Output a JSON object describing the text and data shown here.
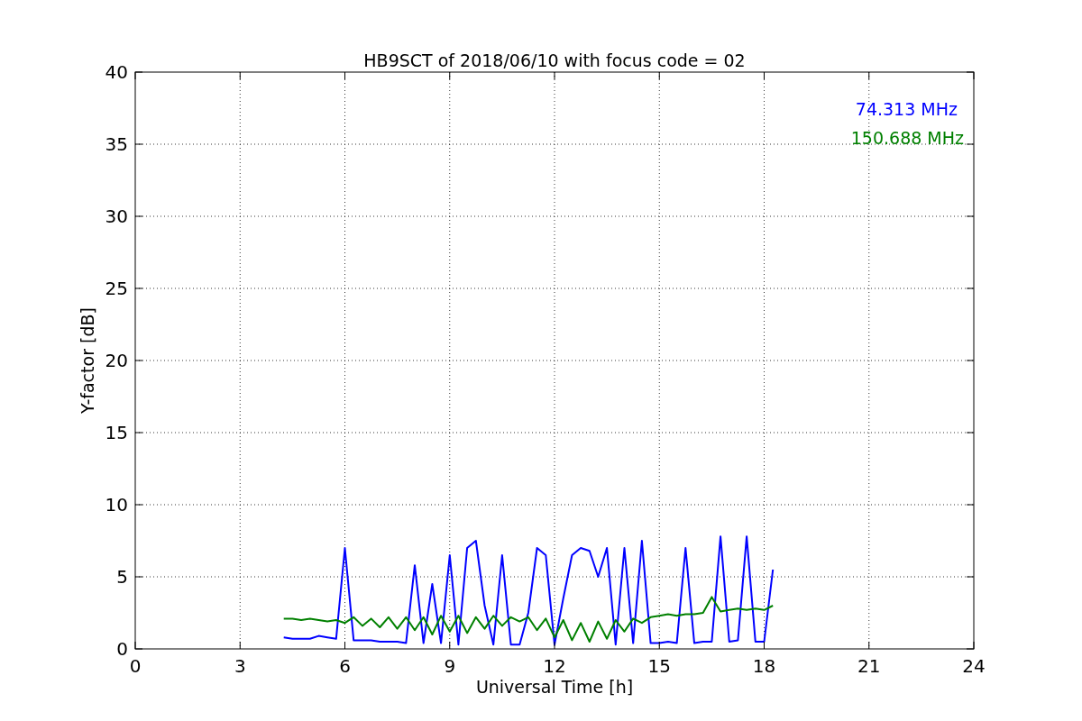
{
  "chart_data": {
    "type": "line",
    "title": "HB9SCT of 2018/06/10 with focus code = 02",
    "xlabel": "Universal Time [h]",
    "ylabel": "Y-factor [dB]",
    "x": [
      4.25,
      4.5,
      4.75,
      5.0,
      5.25,
      5.5,
      5.75,
      6.0,
      6.25,
      6.5,
      6.75,
      7.0,
      7.25,
      7.5,
      7.75,
      8.0,
      8.25,
      8.5,
      8.75,
      9.0,
      9.25,
      9.5,
      9.75,
      10.0,
      10.25,
      10.5,
      10.75,
      11.0,
      11.25,
      11.5,
      11.75,
      12.0,
      12.25,
      12.5,
      12.75,
      13.0,
      13.25,
      13.5,
      13.75,
      14.0,
      14.25,
      14.5,
      14.75,
      15.0,
      15.25,
      15.5,
      15.75,
      16.0,
      16.25,
      16.5,
      16.75,
      17.0,
      17.25,
      17.5,
      17.75,
      18.0,
      18.25
    ],
    "series": [
      {
        "name": "74.313 MHz",
        "color": "#0000ff",
        "values": [
          0.8,
          0.7,
          0.7,
          0.7,
          0.9,
          0.8,
          0.7,
          7.0,
          0.6,
          0.6,
          0.6,
          0.5,
          0.5,
          0.5,
          0.4,
          5.8,
          0.4,
          4.5,
          0.4,
          6.5,
          0.3,
          7.0,
          7.5,
          3.0,
          0.3,
          6.5,
          0.3,
          0.3,
          2.5,
          7.0,
          6.5,
          0.3,
          3.5,
          6.5,
          7.0,
          6.8,
          5.0,
          7.0,
          0.3,
          7.0,
          0.4,
          7.5,
          0.4,
          0.4,
          0.5,
          0.4,
          7.0,
          0.4,
          0.5,
          0.5,
          7.8,
          0.5,
          0.6,
          7.8,
          0.5,
          0.5,
          5.5
        ]
      },
      {
        "name": "150.688 MHz",
        "color": "#008000",
        "values": [
          2.1,
          2.1,
          2.0,
          2.1,
          2.0,
          1.9,
          2.0,
          1.8,
          2.2,
          1.6,
          2.1,
          1.5,
          2.2,
          1.4,
          2.2,
          1.3,
          2.2,
          1.0,
          2.3,
          1.2,
          2.3,
          1.1,
          2.2,
          1.4,
          2.3,
          1.6,
          2.2,
          1.9,
          2.2,
          1.3,
          2.1,
          0.8,
          2.0,
          0.6,
          1.8,
          0.5,
          1.9,
          0.7,
          2.0,
          1.2,
          2.1,
          1.8,
          2.2,
          2.3,
          2.4,
          2.3,
          2.4,
          2.4,
          2.5,
          3.6,
          2.6,
          2.7,
          2.8,
          2.7,
          2.8,
          2.7,
          3.0
        ]
      }
    ],
    "xlim": [
      0,
      24
    ],
    "ylim": [
      0,
      40
    ],
    "xticks": [
      0,
      3,
      6,
      9,
      12,
      15,
      18,
      21,
      24
    ],
    "yticks": [
      0,
      5,
      10,
      15,
      20,
      25,
      30,
      35,
      40
    ],
    "grid": true
  }
}
